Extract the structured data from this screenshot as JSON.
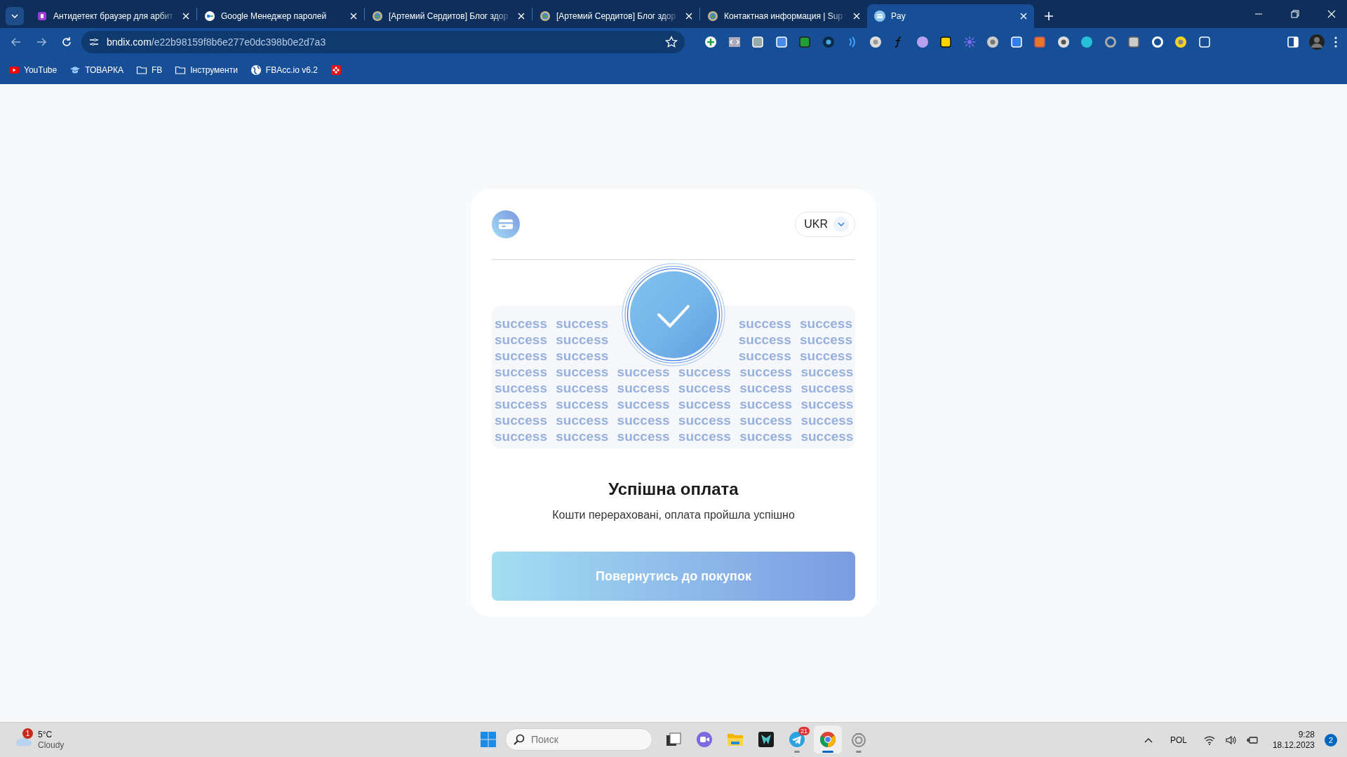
{
  "browser": {
    "tabs": [
      {
        "title": "Антидетект браузер для арбит",
        "kind": "purple",
        "selected": false
      },
      {
        "title": "Google Менеджер паролей",
        "kind": "key",
        "selected": false
      },
      {
        "title": "[Артемий Сердитов] Блог здор",
        "kind": "seal",
        "selected": false
      },
      {
        "title": "[Артемий Сердитов] Блог здор",
        "kind": "seal",
        "selected": false
      },
      {
        "title": "Контактная информация | Sup",
        "kind": "seal",
        "selected": false
      },
      {
        "title": "Pay",
        "kind": "card",
        "selected": true
      }
    ],
    "address": {
      "domain": "bndix.com",
      "path": "/e22b98159f8b6e277e0dc398b0e2d7a3"
    },
    "bookmarks": [
      {
        "label": "YouTube",
        "kind": "youtube"
      },
      {
        "label": "ТОВАРКА",
        "kind": "cap"
      },
      {
        "label": "FB",
        "kind": "folder"
      },
      {
        "label": "Інструменти",
        "kind": "folder"
      },
      {
        "label": "FBAcc.io v6.2",
        "kind": "globe"
      },
      {
        "kind": "app"
      }
    ]
  },
  "page": {
    "language": "UKR",
    "pattern_rows": [
      {
        "segments": [
          "success success",
          "success success"
        ]
      },
      {
        "segments": [
          "success success",
          "success success"
        ]
      },
      {
        "segments": [
          "success success",
          "success success"
        ]
      },
      {
        "segments": [
          "success success success success success success"
        ]
      },
      {
        "segments": [
          "success success success success success success"
        ]
      },
      {
        "segments": [
          "success success success success success success"
        ]
      },
      {
        "segments": [
          "success success success success success success"
        ]
      },
      {
        "segments": [
          "success success success success success success"
        ]
      }
    ],
    "title": "Успішна оплата",
    "message": "Кошти перераховані, оплата пройшла успішно",
    "button": "Повернутись до покупок"
  },
  "taskbar": {
    "weather": {
      "badge": "1",
      "temperature": "5°C",
      "condition": "Cloudy"
    },
    "search": {
      "placeholder": "Поиск"
    },
    "apps": [
      {
        "kind": "taskview",
        "open": false,
        "selected": false
      },
      {
        "kind": "meet",
        "open": false,
        "selected": false
      },
      {
        "kind": "explorer",
        "open": false,
        "selected": false
      },
      {
        "kind": "predator",
        "open": false,
        "selected": false
      },
      {
        "kind": "telegram",
        "badge": "21",
        "open": true,
        "selected": false
      },
      {
        "kind": "chrome",
        "open": true,
        "selected": true
      },
      {
        "kind": "ring",
        "open": true,
        "selected": false
      }
    ],
    "language": "POL",
    "time": "9:28",
    "date": "18.12.2023",
    "notifications": "2"
  }
}
